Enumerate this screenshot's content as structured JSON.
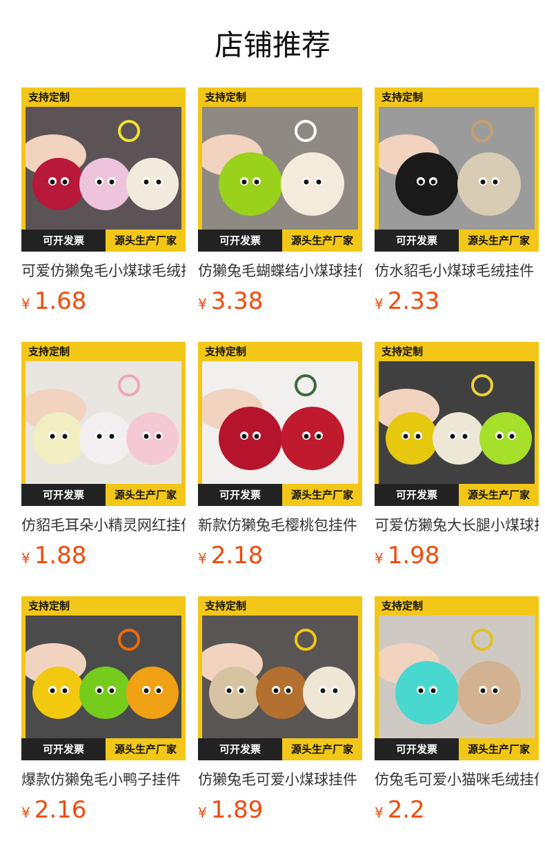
{
  "title": "店铺推荐",
  "badge_top": "支持定制",
  "badge_left": "可开发票",
  "badge_right": "源头生产厂家",
  "currency": "¥",
  "colors": {
    "accent": "#f3c718",
    "price": "#f04a0a",
    "dark": "#222222"
  },
  "products": [
    {
      "name": "可爱仿獭兔毛小煤球毛绒挂件",
      "price": "1.68",
      "bg": "#5b5356",
      "balls": [
        "#b8193a",
        "#eec3dc",
        "#f0ebdc"
      ],
      "deco": "#f4e230"
    },
    {
      "name": "仿獭兔毛蝴蝶结小煤球挂件",
      "price": "3.38",
      "bg": "#8f8984",
      "balls": [
        "#9ad11a",
        "#f4ebdc"
      ],
      "deco": "#ffffff"
    },
    {
      "name": "仿水貂毛小煤球毛绒挂件",
      "price": "2.33",
      "bg": "#9b9b9b",
      "balls": [
        "#1a1a1a",
        "#d9ccb4"
      ],
      "deco": "#c79e6c"
    },
    {
      "name": "仿貂毛耳朵小精灵网红挂件",
      "price": "1.88",
      "bg": "#e9e6e2",
      "balls": [
        "#f2eec1",
        "#f3eff1",
        "#f4c8d4"
      ],
      "deco": "#f0a6b4"
    },
    {
      "name": "新款仿獭兔毛樱桃包挂件",
      "price": "2.18",
      "bg": "#f1f0ef",
      "balls": [
        "#b5142c",
        "#c01a2e"
      ],
      "deco": "#3b6b3a"
    },
    {
      "name": "可爱仿獭兔大长腿小煤球挂件",
      "price": "1.98",
      "bg": "#404040",
      "balls": [
        "#e6c80f",
        "#ede7d5",
        "#a6e02a"
      ],
      "deco": "#ecd23a"
    },
    {
      "name": "爆款仿獭兔毛小鸭子挂件",
      "price": "2.16",
      "bg": "#4b4b4b",
      "balls": [
        "#f3c90f",
        "#75cc1c",
        "#f1a114"
      ],
      "deco": "#f06a10"
    },
    {
      "name": "仿獭兔毛可爱小煤球挂件",
      "price": "1.89",
      "bg": "#5a5555",
      "balls": [
        "#d6c3a1",
        "#b3702e",
        "#efe6d6"
      ],
      "deco": "#f3c70e"
    },
    {
      "name": "仿兔毛可爱小猫咪毛绒挂件",
      "price": "2.2",
      "bg": "#cfc9c4",
      "balls": [
        "#49d8d0",
        "#d2b291"
      ],
      "deco": "#e3c020"
    }
  ]
}
